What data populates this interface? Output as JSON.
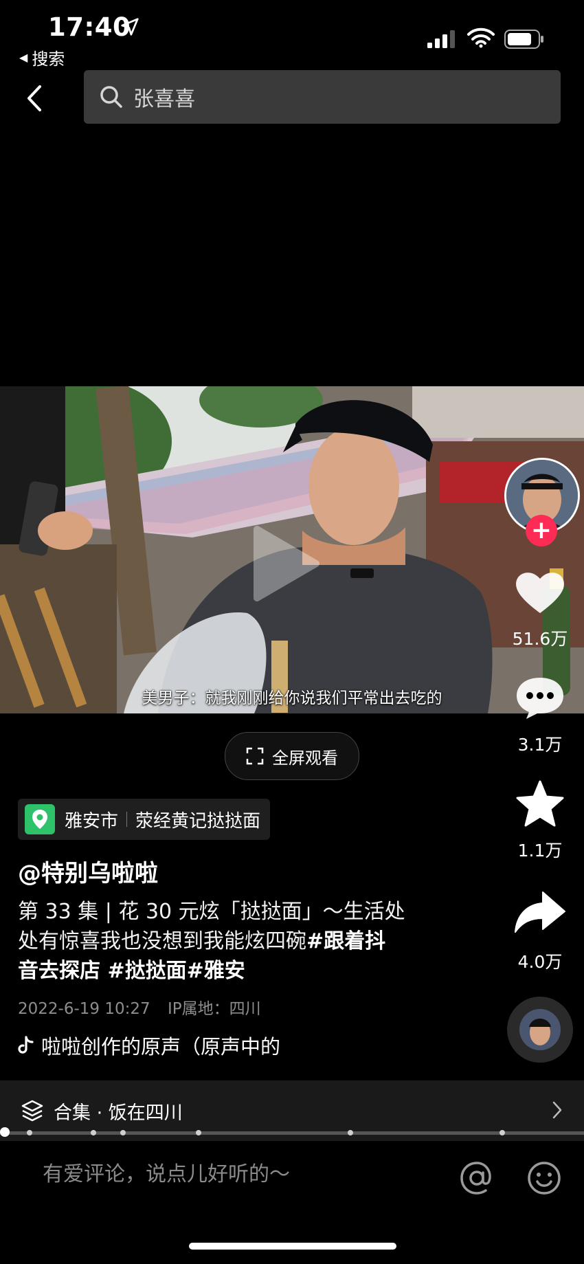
{
  "status_bar": {
    "time": "17:40",
    "back_app_label": "搜索"
  },
  "search": {
    "query": "张喜喜"
  },
  "video": {
    "subtitle": "美男子：就我刚刚给你说我们平常出去吃的",
    "fullscreen_label": "全屏观看"
  },
  "rail": {
    "likes": "51.6万",
    "comments": "3.1万",
    "favorites": "1.1万",
    "shares": "4.0万"
  },
  "info": {
    "poi_city": "雅安市",
    "poi_name": "荥经黄记挞挞面",
    "author": "@特别乌啦啦",
    "desc_line1": "第 33 集 | 花 30 元炫「挞挞面」～生活处",
    "desc_line2_plain": "处有惊喜我也没想到我能炫四碗",
    "desc_line2_tag": "#跟着抖",
    "desc_line3_tag": "音去探店 #挞挞面#雅安",
    "date": "2022-6-19 10:27",
    "ip": "IP属地：四川",
    "music": "啦啦创作的原声（原声中的"
  },
  "collection": {
    "label": "合集 · 饭在四川"
  },
  "progress": {
    "played": 0.0,
    "markers": [
      0.05,
      0.16,
      0.21,
      0.34,
      0.6,
      0.86
    ]
  },
  "comment_bar": {
    "placeholder": "有爱评论，说点儿好听的～"
  },
  "colors": {
    "accent_red": "#fe2c55",
    "poi_green": "#2ec26a"
  },
  "icons": [
    "location-arrow-icon",
    "signal-icon",
    "wifi-icon",
    "battery-icon",
    "back-chevron-icon",
    "search-icon",
    "play-icon",
    "fullscreen-icon",
    "plus-icon",
    "heart-icon",
    "comment-icon",
    "star-icon",
    "share-icon",
    "map-pin-icon",
    "tiktok-note-icon",
    "layers-icon",
    "chevron-right-icon",
    "at-icon",
    "emoji-icon"
  ]
}
